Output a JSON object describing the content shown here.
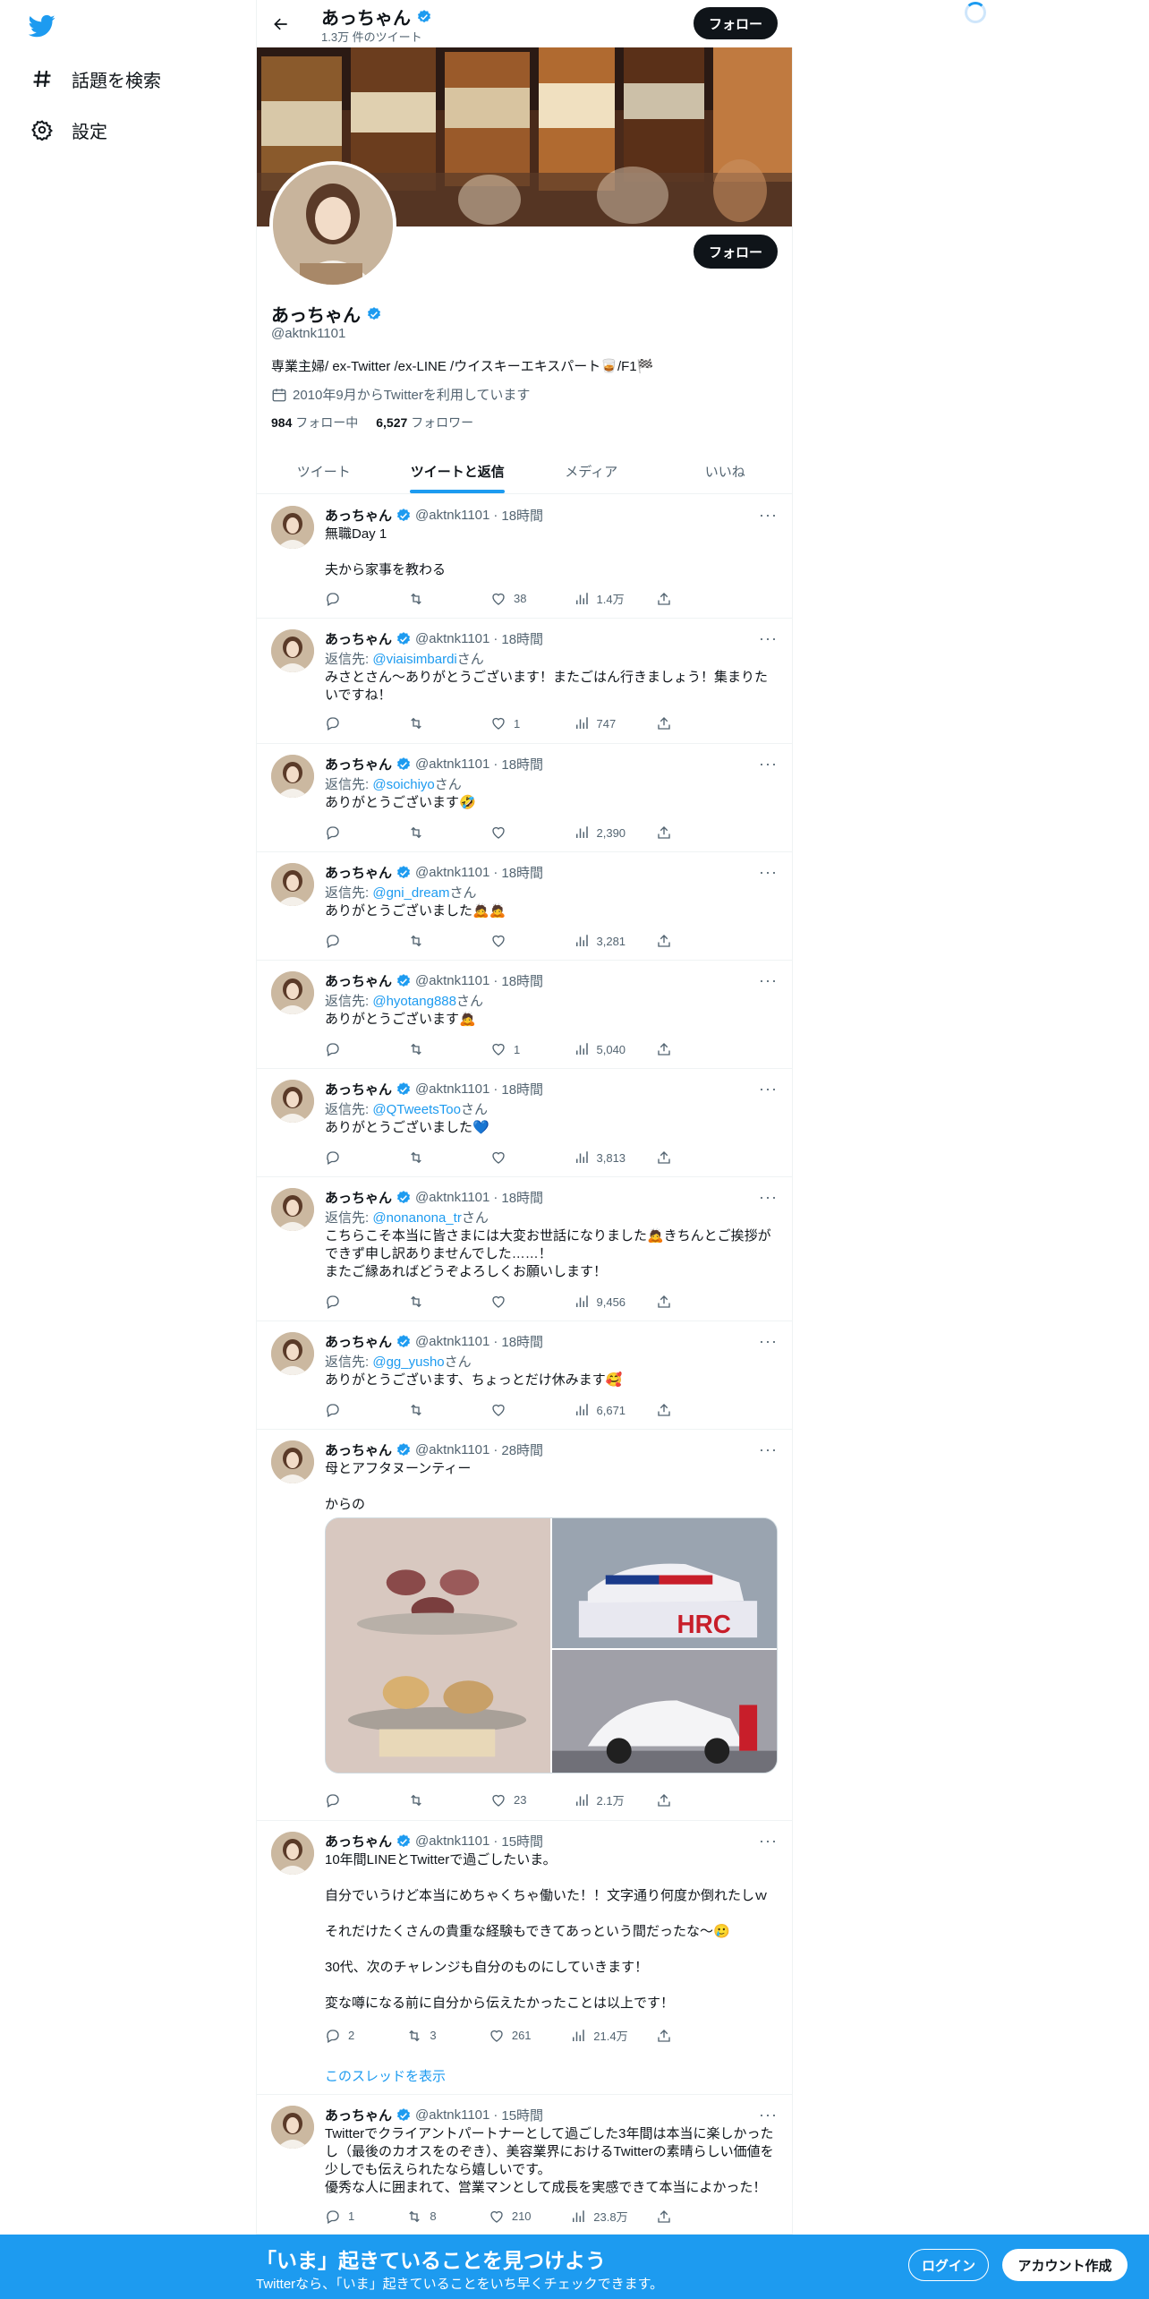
{
  "nav": {
    "explore": "話題を検索",
    "settings": "設定"
  },
  "header": {
    "name": "あっちゃん",
    "tweet_count": "1.3万 件のツイート",
    "follow": "フォロー"
  },
  "profile": {
    "name": "あっちゃん",
    "handle": "@aktnk1101",
    "bio": "専業主婦/ ex-Twitter /ex-LINE /ウイスキーエキスパート🥃/F1🏁",
    "joined": "2010年9月からTwitterを利用しています",
    "following_count": "984",
    "following_label": "フォロー中",
    "followers_count": "6,527",
    "followers_label": "フォロワー",
    "follow": "フォロー"
  },
  "tabs": [
    "ツイート",
    "ツイートと返信",
    "メディア",
    "いいね"
  ],
  "tweets": [
    {
      "name": "あっちゃん",
      "handle": "@aktnk1101",
      "time": "18時間",
      "reply_to": "",
      "text": "無職Day 1\n\n夫から家事を教わる",
      "replies": "",
      "retweets": "",
      "likes": "38",
      "views": "1.4万"
    },
    {
      "name": "あっちゃん",
      "handle": "@aktnk1101",
      "time": "18時間",
      "reply_to": "@viaisimbardi",
      "text": "みさとさん〜ありがとうございます！またごはん行きましょう！集まりたいですね！",
      "replies": "",
      "retweets": "",
      "likes": "1",
      "views": "747"
    },
    {
      "name": "あっちゃん",
      "handle": "@aktnk1101",
      "time": "18時間",
      "reply_to": "@soichiyo",
      "text": "ありがとうございます🤣",
      "replies": "",
      "retweets": "",
      "likes": "",
      "views": "2,390"
    },
    {
      "name": "あっちゃん",
      "handle": "@aktnk1101",
      "time": "18時間",
      "reply_to": "@gni_dream",
      "text": "ありがとうございました🙇🙇",
      "replies": "",
      "retweets": "",
      "likes": "",
      "views": "3,281"
    },
    {
      "name": "あっちゃん",
      "handle": "@aktnk1101",
      "time": "18時間",
      "reply_to": "@hyotang888",
      "text": "ありがとうございます🙇",
      "replies": "",
      "retweets": "",
      "likes": "1",
      "views": "5,040"
    },
    {
      "name": "あっちゃん",
      "handle": "@aktnk1101",
      "time": "18時間",
      "reply_to": "@QTweetsToo",
      "text": "ありがとうございました💙",
      "replies": "",
      "retweets": "",
      "likes": "",
      "views": "3,813"
    },
    {
      "name": "あっちゃん",
      "handle": "@aktnk1101",
      "time": "18時間",
      "reply_to": "@nonanona_tr",
      "text": "こちらこそ本当に皆さまには大変お世話になりました🙇きちんとご挨拶ができず申し訳ありませんでした……！\nまたご縁あればどうぞよろしくお願いします！",
      "replies": "",
      "retweets": "",
      "likes": "",
      "views": "9,456"
    },
    {
      "name": "あっちゃん",
      "handle": "@aktnk1101",
      "time": "18時間",
      "reply_to": "@gg_yusho",
      "text": "ありがとうございます、ちょっとだけ休みます🥰",
      "replies": "",
      "retweets": "",
      "likes": "",
      "views": "6,671"
    },
    {
      "name": "あっちゃん",
      "handle": "@aktnk1101",
      "time": "28時間",
      "reply_to": "",
      "text": "母とアフタヌーンティー\n\nからの",
      "replies": "",
      "retweets": "",
      "likes": "23",
      "views": "2.1万"
    },
    {
      "name": "あっちゃん",
      "handle": "@aktnk1101",
      "time": "15時間",
      "reply_to": "",
      "text": "10年間LINEとTwitterで過ごしたいま。\n\n自分でいうけど本当にめちゃくちゃ働いた！！文字通り何度か倒れたしｗ\n\nそれだけたくさんの貴重な経験もできてあっという間だったな〜🥲\n\n30代、次のチャレンジも自分のものにしていきます！\n\n変な噂になる前に自分から伝えたかったことは以上です！",
      "replies": "2",
      "retweets": "3",
      "likes": "261",
      "views": "21.4万"
    },
    {
      "name": "あっちゃん",
      "handle": "@aktnk1101",
      "time": "15時間",
      "reply_to": "",
      "text": "Twitterでクライアントパートナーとして過ごした3年間は本当に楽しかったし（最後のカオスをのぞき）、美容業界におけるTwitterの素晴らしい価値を少しでも伝えられたなら嬉しいです。\n優秀な人に囲まれて、営業マンとして成長を実感できて本当によかった！",
      "replies": "1",
      "retweets": "8",
      "likes": "210",
      "views": "23.8万"
    }
  ],
  "reply_prefix": "返信先: ",
  "reply_suffix": "さん",
  "thread_link": "このスレッドを表示",
  "bottom": {
    "title": "「いま」起きていることを見つけよう",
    "subtitle": "Twitterなら、「いま」起きていることをいち早くチェックできます。",
    "login": "ログイン",
    "signup": "アカウント作成"
  },
  "colors": {
    "accent": "#1d9bf0",
    "text": "#0f1419",
    "muted": "#536471"
  },
  "icons": [
    "twitter-bird-icon",
    "hashtag-icon",
    "gear-icon",
    "back-arrow-icon",
    "verified-badge-icon",
    "calendar-icon",
    "reply-icon",
    "retweet-icon",
    "like-icon",
    "views-icon",
    "share-icon",
    "more-icon"
  ]
}
